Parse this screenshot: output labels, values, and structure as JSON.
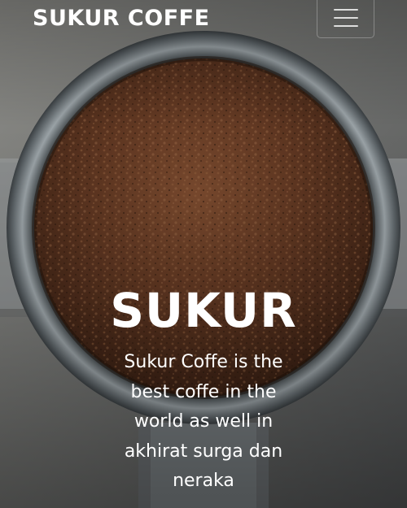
{
  "navbar": {
    "brand": "SUKUR COFFE",
    "menu_icon": "hamburger-menu-icon"
  },
  "hero": {
    "background_icon": "coffee-grounds-portafilter-image",
    "title": "SUKUR",
    "description": "Sukur Coffe is the best coffe in the world as well in akhirat surga dan neraka"
  },
  "colors": {
    "text": "#ffffff",
    "coffee": "#5a3220",
    "metal": "#8a8f93",
    "background": "#6b6b6b"
  }
}
